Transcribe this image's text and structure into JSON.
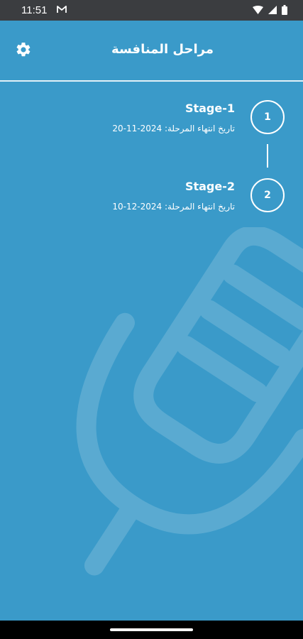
{
  "status_bar": {
    "time": "11:51",
    "icons": [
      "gmail-icon",
      "wifi-icon",
      "signal-icon",
      "battery-icon"
    ]
  },
  "header": {
    "title": "مراحل المنافسة",
    "settings_icon": "gear-icon"
  },
  "stages": [
    {
      "number": "1",
      "name": "Stage-1",
      "end_date_text": "تاريخ انتهاء المرحلة: 2024-11-20"
    },
    {
      "number": "2",
      "name": "Stage-2",
      "end_date_text": "تاريخ انتهاء المرحلة: 2024-12-10"
    }
  ],
  "colors": {
    "background": "#3a9ac9",
    "status_bar": "#3b3d40",
    "text": "#ffffff"
  }
}
